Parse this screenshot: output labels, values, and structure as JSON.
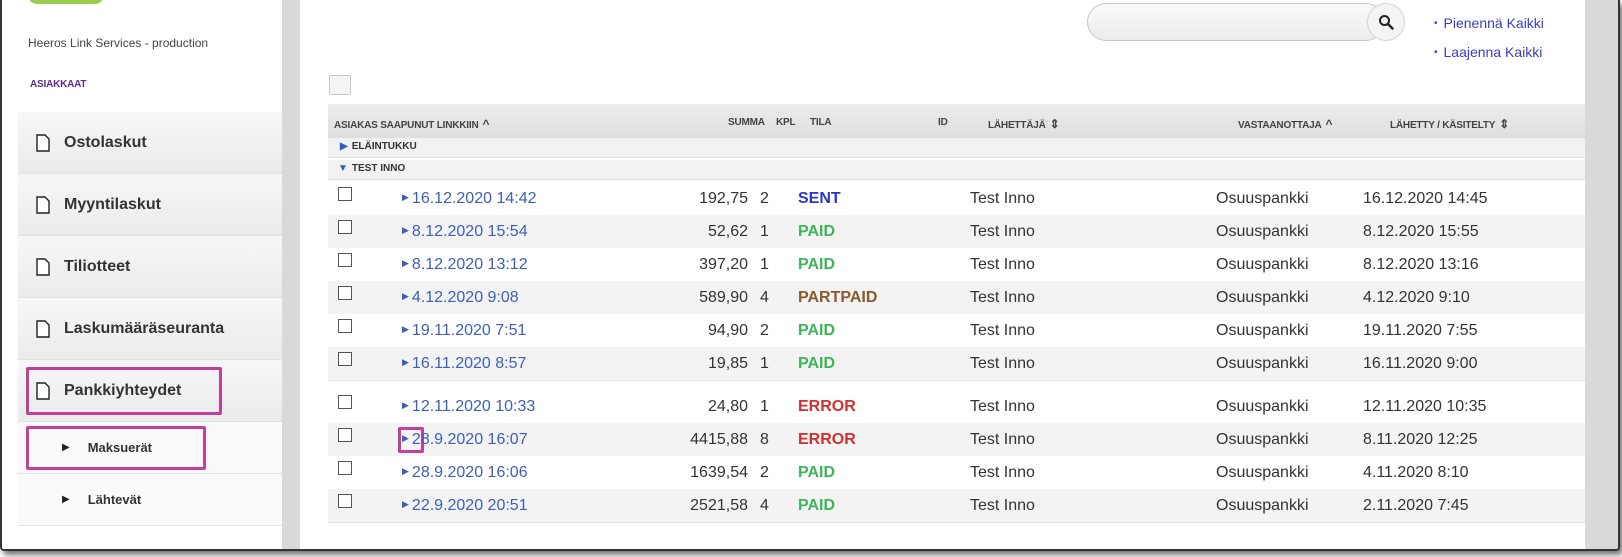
{
  "app": {
    "service_name": "Heeros Link Services - production",
    "customers_link": "ASIAKKAAT"
  },
  "sidebar": {
    "items": [
      {
        "label": "Ostolaskut",
        "icon": "document-icon"
      },
      {
        "label": "Myyntilaskut",
        "icon": "document-icon"
      },
      {
        "label": "Tiliotteet",
        "icon": "document-icon"
      },
      {
        "label": "Laskumääräseuranta",
        "icon": "document-icon"
      },
      {
        "label": "Pankkiyhteydet",
        "icon": "document-icon",
        "highlighted": true
      }
    ],
    "subitems": [
      {
        "label": "Maksuerät",
        "highlighted": true
      },
      {
        "label": "Lähtevät"
      }
    ]
  },
  "toolbar": {
    "search_placeholder": "",
    "collapse_all": "Pienennä Kaikki",
    "expand_all": "Laajenna Kaikki"
  },
  "table": {
    "headers": {
      "customer": "ASIAKAS",
      "arrived": "SAAPUNUT LINKKIIN",
      "sum": "SUMMA",
      "count": "KPL",
      "status": "TILA",
      "id": "ID",
      "sender": "LÄHETTÄJÄ",
      "receiver": "VASTAANOTTAJA",
      "sent_processed": "LÄHETTY / KÄSITELTY"
    },
    "groups": [
      {
        "name": "ELÄINTUKKU",
        "expanded": false
      },
      {
        "name": "TEST INNO",
        "expanded": true
      }
    ],
    "rows": [
      {
        "arrived": "16.12.2020 14:42",
        "sum": "192,75",
        "count": "2",
        "status": "SENT",
        "sender": "Test Inno",
        "receiver": "Osuuspankki",
        "processed": "16.12.2020 14:45"
      },
      {
        "arrived": "8.12.2020 15:54",
        "sum": "52,62",
        "count": "1",
        "status": "PAID",
        "sender": "Test Inno",
        "receiver": "Osuuspankki",
        "processed": "8.12.2020 15:55"
      },
      {
        "arrived": "8.12.2020 13:12",
        "sum": "397,20",
        "count": "1",
        "status": "PAID",
        "sender": "Test Inno",
        "receiver": "Osuuspankki",
        "processed": "8.12.2020 13:16"
      },
      {
        "arrived": "4.12.2020 9:08",
        "sum": "589,90",
        "count": "4",
        "status": "PARTPAID",
        "sender": "Test Inno",
        "receiver": "Osuuspankki",
        "processed": "4.12.2020 9:10"
      },
      {
        "arrived": "19.11.2020 7:51",
        "sum": "94,90",
        "count": "2",
        "status": "PAID",
        "sender": "Test Inno",
        "receiver": "Osuuspankki",
        "processed": "19.11.2020 7:55"
      },
      {
        "arrived": "16.11.2020 8:57",
        "sum": "19,85",
        "count": "1",
        "status": "PAID",
        "sender": "Test Inno",
        "receiver": "Osuuspankki",
        "processed": "16.11.2020 9:00"
      },
      {
        "arrived": "12.11.2020 10:33",
        "sum": "24,80",
        "count": "1",
        "status": "ERROR",
        "sender": "Test Inno",
        "receiver": "Osuuspankki",
        "processed": "12.11.2020 10:35"
      },
      {
        "arrived": "28.9.2020 16:07",
        "sum": "4415,88",
        "count": "8",
        "status": "ERROR",
        "sender": "Test Inno",
        "receiver": "Osuuspankki",
        "processed": "8.11.2020 12:25"
      },
      {
        "arrived": "28.9.2020 16:06",
        "sum": "1639,54",
        "count": "2",
        "status": "PAID",
        "sender": "Test Inno",
        "receiver": "Osuuspankki",
        "processed": "4.11.2020 8:10"
      },
      {
        "arrived": "22.9.2020 20:51",
        "sum": "2521,58",
        "count": "4",
        "status": "PAID",
        "sender": "Test Inno",
        "receiver": "Osuuspankki",
        "processed": "2.11.2020 7:45"
      }
    ]
  },
  "colors": {
    "accent_highlight": "#c0409a",
    "link": "#3c5fb8",
    "sent": "#2a37c8",
    "paid": "#3cb65a",
    "partpaid": "#8b5a2b",
    "error": "#d03030"
  }
}
